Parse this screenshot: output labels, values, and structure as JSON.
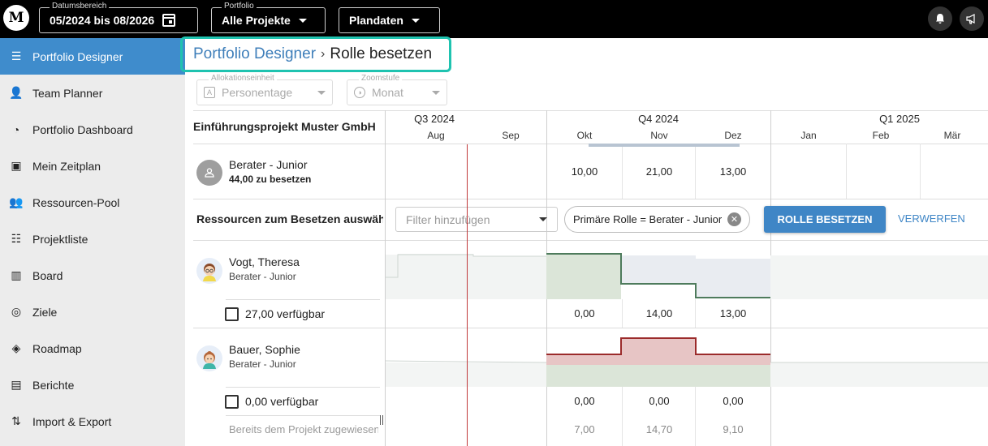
{
  "topbar": {
    "logo": "M",
    "date_range": {
      "caption": "Datumsbereich",
      "value": "05/2024 bis 08/2026"
    },
    "portfolio": {
      "caption": "Portfolio",
      "value": "Alle Projekte"
    },
    "plandata": {
      "value": "Plandaten"
    },
    "icons": [
      "bell-icon",
      "megaphone-icon"
    ]
  },
  "sidebar": {
    "items": [
      {
        "label": "Portfolio Designer",
        "icon": "designer-icon",
        "active": true
      },
      {
        "label": "Team Planner",
        "icon": "team-icon"
      },
      {
        "label": "Portfolio Dashboard",
        "icon": "dashboard-icon"
      },
      {
        "label": "Mein Zeitplan",
        "icon": "schedule-icon"
      },
      {
        "label": "Ressourcen-Pool",
        "icon": "people-icon"
      },
      {
        "label": "Projektliste",
        "icon": "list-icon"
      },
      {
        "label": "Board",
        "icon": "board-icon"
      },
      {
        "label": "Ziele",
        "icon": "target-icon"
      },
      {
        "label": "Roadmap",
        "icon": "roadmap-icon"
      },
      {
        "label": "Berichte",
        "icon": "report-icon"
      },
      {
        "label": "Import & Export",
        "icon": "import-export-icon"
      }
    ]
  },
  "breadcrumb": {
    "link": "Portfolio Designer",
    "separator": "›",
    "current": "Rolle besetzen"
  },
  "selectors": {
    "allocation": {
      "caption": "Allokationseinheit",
      "value": "Personentage"
    },
    "zoom": {
      "caption": "Zoomstufe",
      "value": "Monat"
    }
  },
  "timeline": {
    "quarters": [
      "Q3 2024",
      "Q4 2024",
      "Q1 2025"
    ],
    "months": [
      "Aug",
      "Sep",
      "Okt",
      "Nov",
      "Dez",
      "Jan",
      "Feb",
      "Mär"
    ]
  },
  "project": {
    "title": "Einführungsprojekt Muster GmbH",
    "role": {
      "name": "Berater - Junior",
      "to_fill": "44,00 zu besetzen",
      "values": [
        "10,00",
        "21,00",
        "13,00"
      ]
    }
  },
  "resources": {
    "title": "Ressourcen zum Besetzen auswählen",
    "filter_placeholder": "Filter hinzufügen",
    "chip": "Primäre Rolle = Berater - Junior",
    "primary_button": "ROLLE BESETZEN",
    "discard_button": "VERWERFEN",
    "people": [
      {
        "name": "Vogt, Theresa",
        "role": "Berater - Junior",
        "available": "27,00 verfügbar",
        "values": [
          "0,00",
          "14,00",
          "13,00"
        ]
      },
      {
        "name": "Bauer, Sophie",
        "role": "Berater - Junior",
        "available": "0,00 verfügbar",
        "values": [
          "0,00",
          "0,00",
          "0,00"
        ]
      }
    ],
    "assigned_label": "Bereits dem Projekt zugewiesen",
    "assigned_values": [
      "7,00",
      "14,70",
      "9,10"
    ]
  },
  "colors": {
    "accent": "#3f8ccc",
    "highlight": "#1fc3b0",
    "today_line": "#c0393b"
  }
}
